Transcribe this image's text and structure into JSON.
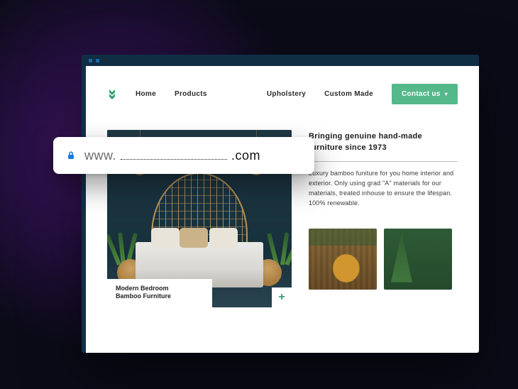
{
  "nav": {
    "items": [
      "Home",
      "Products",
      "Upholstery",
      "Custom Made"
    ],
    "contact_label": "Contact us"
  },
  "hero": {
    "caption_line1": "Modern Bedroom",
    "caption_line2": "Bamboo Furniture",
    "headline": "Bringing genuine hand-made furniture since 1973",
    "body": "Luxury bamboo funiture for you home interior and exterior. Only using grad \"A\" materials for our materials, treated inhouse to ensure the lifespan. 100% renewable."
  },
  "addressbar": {
    "prefix": "www.",
    "suffix": ".com"
  }
}
